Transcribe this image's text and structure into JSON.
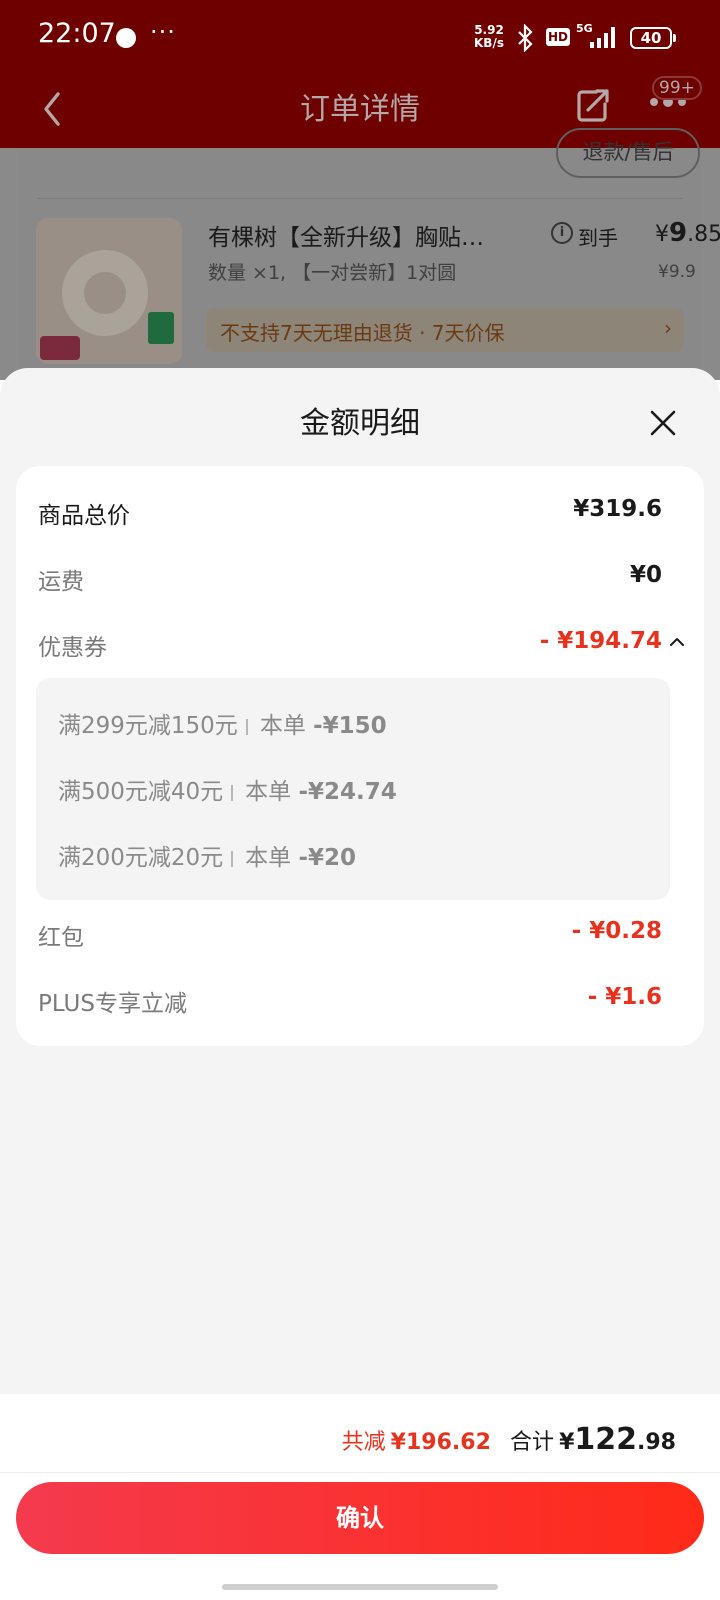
{
  "status_bar": {
    "time": "22:07",
    "more": "···",
    "speed_value": "5.92",
    "speed_unit": "KB/s",
    "hd": "HD",
    "network": "5G",
    "battery": "40"
  },
  "header": {
    "title": "订单详情",
    "badge": "99+",
    "icons": [
      "back-icon",
      "share-icon",
      "more-icon"
    ]
  },
  "background_order": {
    "after_sale_button": "退款/售后",
    "product": {
      "title": "有棵树【全新升级】胸贴…",
      "price_label": "到手",
      "price_currency": "¥",
      "price_integer": "9",
      "price_decimal": ".85",
      "spec": "数量 ×1, 【一对尝新】1对圆",
      "original_price": "¥9.9",
      "notice": "不支持7天无理由退货 · 7天价保",
      "notice_arrow": "›"
    }
  },
  "sheet": {
    "title": "金额明细",
    "rows": {
      "goods_total": {
        "label": "商品总价",
        "value": "¥319.6"
      },
      "shipping": {
        "label": "运费",
        "value": "¥0"
      },
      "coupon": {
        "label": "优惠券",
        "value": "- ¥194.74"
      },
      "red_packet": {
        "label": "红包",
        "value": "- ¥0.28"
      },
      "plus": {
        "label": "PLUS专享立减",
        "value": "- ¥1.6"
      }
    },
    "coupons": [
      {
        "name": "满299元减150元",
        "scope": "本单",
        "amount": "-¥150"
      },
      {
        "name": "满500元减40元",
        "scope": "本单",
        "amount": "-¥24.74"
      },
      {
        "name": "满200元减20元",
        "scope": "本单",
        "amount": "-¥20"
      }
    ]
  },
  "footer": {
    "saved_label": "共减",
    "saved_value": "¥196.62",
    "total_label": "合计",
    "total_currency": "¥",
    "total_integer": "122",
    "total_decimal": ".98",
    "confirm_label": "确认"
  },
  "colors": {
    "header_bg": "#6f0000",
    "accent_red": "#e8321e",
    "button_gradient_start": "#f43a4d",
    "button_gradient_end": "#ff2a18",
    "sheet_bg": "#f4f4f4"
  }
}
